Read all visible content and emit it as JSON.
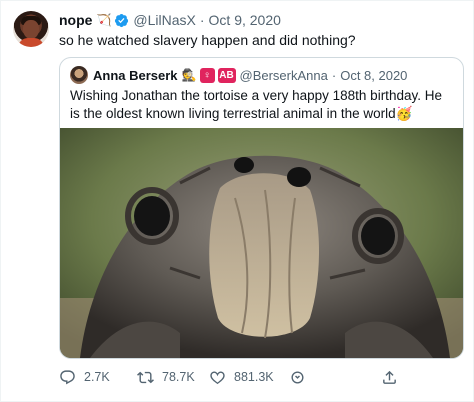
{
  "author": {
    "name": "nope",
    "name_emoji": "🏹",
    "handle": "@LilNasX",
    "date": "Oct 9, 2020",
    "verified": true
  },
  "tweet_text": "so he watched slavery happen and did nothing?",
  "quoted_tweet": {
    "name": "Anna Berserk",
    "badges": [
      "🕵",
      "♀",
      "AB"
    ],
    "handle": "@BerserkAnna",
    "date": "Oct 8, 2020",
    "text": "Wishing Jonathan the tortoise a very happy 188th birthday. He is the oldest known living terrestrial animal in the world🥳",
    "image": "tortoise-face-photo"
  },
  "actions": {
    "reply_count": "2.7K",
    "retweet_count": "78.7K",
    "like_count": "881.3K"
  },
  "colors": {
    "text": "#0f1419",
    "muted": "#536471",
    "verified": "#1d9bf0",
    "border": "#cfd9de",
    "badge": "#e0245e"
  }
}
